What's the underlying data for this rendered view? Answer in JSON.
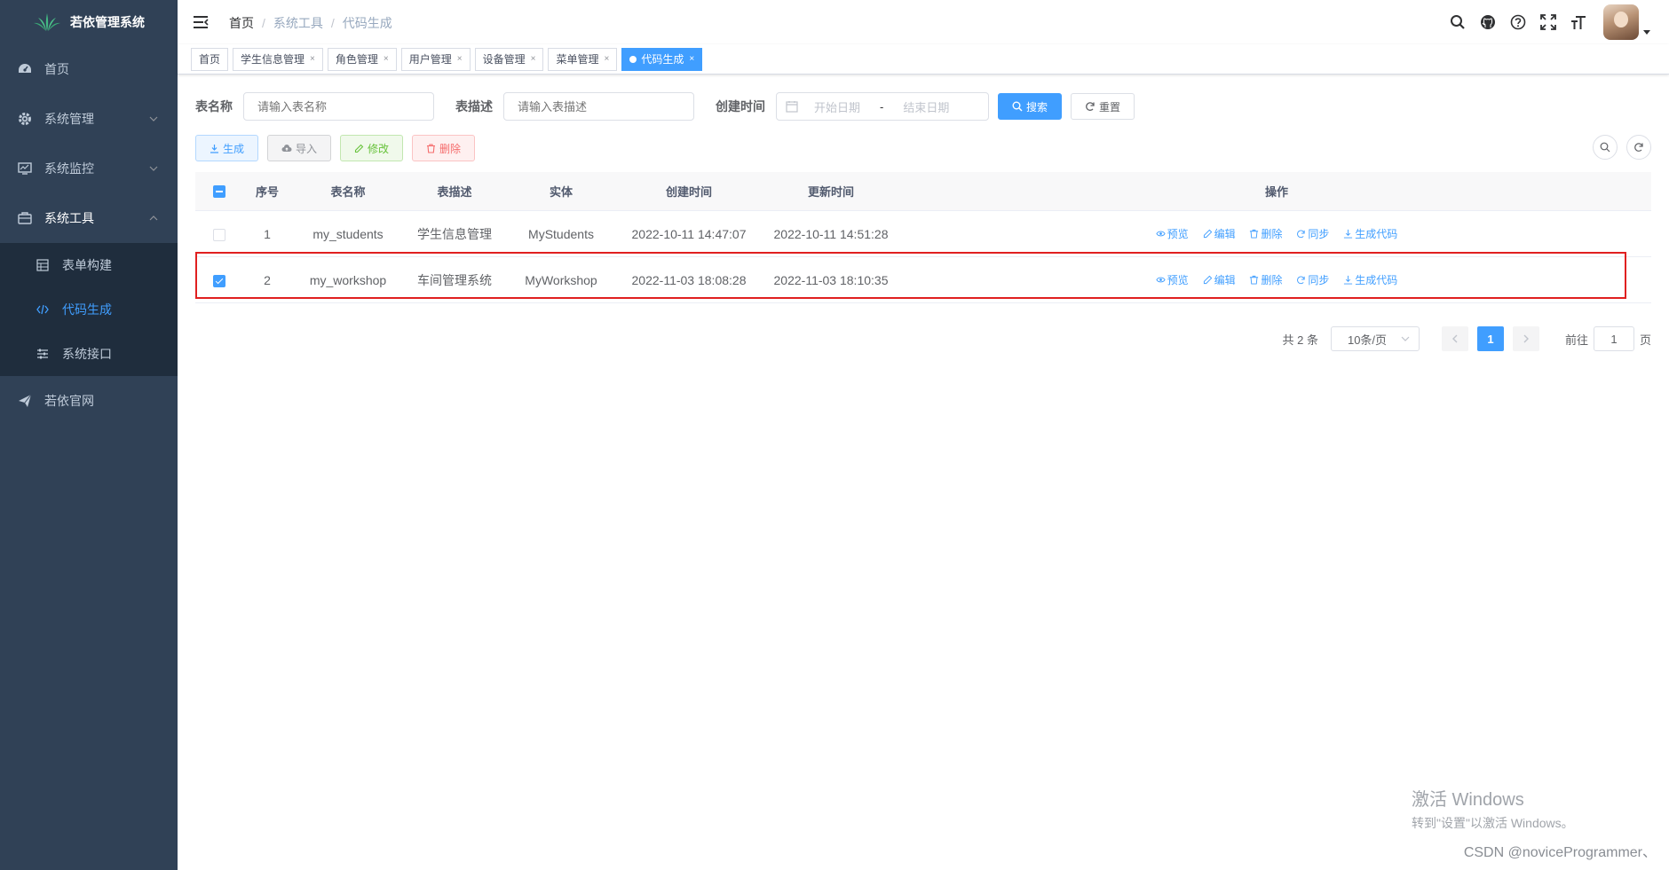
{
  "app": {
    "title": "若依管理系统"
  },
  "sidebar": {
    "items": [
      {
        "label": "首页",
        "icon": "dashboard-icon"
      },
      {
        "label": "系统管理",
        "icon": "gear-icon"
      },
      {
        "label": "系统监控",
        "icon": "monitor-icon"
      },
      {
        "label": "系统工具",
        "icon": "toolbox-icon"
      },
      {
        "label": "若依官网",
        "icon": "paper-plane-icon"
      }
    ],
    "tools_submenu": [
      {
        "label": "表单构建",
        "icon": "form-icon"
      },
      {
        "label": "代码生成",
        "icon": "code-icon"
      },
      {
        "label": "系统接口",
        "icon": "sliders-icon"
      }
    ]
  },
  "breadcrumb": [
    "首页",
    "系统工具",
    "代码生成"
  ],
  "tags": [
    "首页",
    "学生信息管理",
    "角色管理",
    "用户管理",
    "设备管理",
    "菜单管理",
    "代码生成"
  ],
  "search": {
    "table_name_label": "表名称",
    "table_name_placeholder": "请输入表名称",
    "table_desc_label": "表描述",
    "table_desc_placeholder": "请输入表描述",
    "created_label": "创建时间",
    "start_placeholder": "开始日期",
    "range_sep": "-",
    "end_placeholder": "结束日期",
    "search_btn": "搜索",
    "reset_btn": "重置"
  },
  "toolbar": {
    "generate": "生成",
    "import": "导入",
    "edit": "修改",
    "delete": "删除"
  },
  "table": {
    "headers": [
      "序号",
      "表名称",
      "表描述",
      "实体",
      "创建时间",
      "更新时间",
      "操作"
    ],
    "rows": [
      {
        "idx": "1",
        "name": "my_students",
        "desc": "学生信息管理",
        "entity": "MyStudents",
        "created": "2022-10-11 14:47:07",
        "updated": "2022-10-11 14:51:28",
        "checked": false
      },
      {
        "idx": "2",
        "name": "my_workshop",
        "desc": "车间管理系统",
        "entity": "MyWorkshop",
        "created": "2022-11-03 18:08:28",
        "updated": "2022-11-03 18:10:35",
        "checked": true
      }
    ],
    "ops": [
      "预览",
      "编辑",
      "删除",
      "同步",
      "生成代码"
    ]
  },
  "pagination": {
    "total": "共 2 条",
    "page_size": "10条/页",
    "current": "1",
    "goto_label": "前往",
    "goto_value": "1",
    "page_suffix": "页"
  },
  "watermark": {
    "windows_title": "激活 Windows",
    "windows_sub": "转到\"设置\"以激活 Windows。",
    "csdn": "CSDN @noviceProgrammer、"
  },
  "colors": {
    "sidebar_bg": "#304156",
    "submenu_bg": "#1f2d3d",
    "accent": "#409eff",
    "highlight": "#e02020"
  }
}
